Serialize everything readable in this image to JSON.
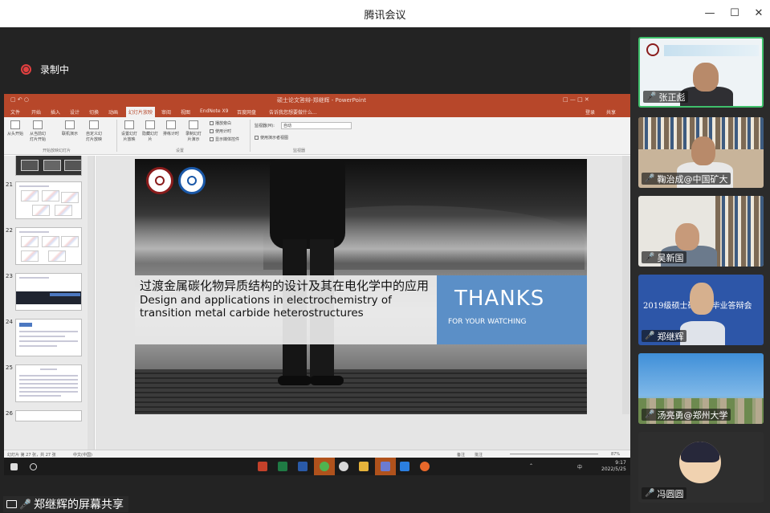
{
  "window": {
    "title": "腾讯会议"
  },
  "recording": {
    "label": "录制中"
  },
  "shared_screen": {
    "ppt_window_title": "硕士论文答辩-郑继辉 - PowerPoint",
    "ribbon_tabs": [
      "文件",
      "开始",
      "插入",
      "设计",
      "切换",
      "动画",
      "幻灯片放映",
      "审阅",
      "视图",
      "EndNote X9",
      "百度网盘"
    ],
    "active_tab": "幻灯片放映",
    "tell_me": "告诉我您想要做什么...",
    "account": "登录",
    "share": "共享",
    "ribbon_buttons": [
      "从头开始",
      "从当前幻灯片开始",
      "联机演示",
      "自定义幻灯片放映",
      "设置幻灯片放映",
      "隐藏幻灯片",
      "排练计时",
      "录制幻灯片演示"
    ],
    "ribbon_checks": [
      "播放旁白",
      "使用计时",
      "显示媒体控件"
    ],
    "monitor_label": "监视器(M):",
    "monitor_value": "自动",
    "presenter_view": "使用演示者视图",
    "groups": [
      "开始放映幻灯片",
      "设置",
      "监视器"
    ],
    "thumbnail_numbers": [
      "21",
      "22",
      "23",
      "24",
      "25",
      "26"
    ],
    "slide": {
      "title_cn": "过渡金属碳化物异质结构的设计及其在电化学中的应用",
      "title_en": "Design and applications in electrochemistry of transition metal carbide heterostructures",
      "thanks": "THANKS",
      "thanks_sub": "FOR YOUR WATCHING"
    },
    "status_bar": {
      "slide_info": "幻灯片 第 27 张，共 27 张",
      "language": "中文(中国)",
      "notes": "备注",
      "comments": "批注",
      "zoom": "87%"
    },
    "taskbar": {
      "time": "9:17",
      "date": "2022/5/25",
      "ime": "中"
    }
  },
  "share_label": {
    "text": "郑继辉的屏幕共享"
  },
  "participants": [
    {
      "name": "张正彪",
      "muted": false,
      "active": true
    },
    {
      "name": "鞠治成@中国矿大",
      "muted": true,
      "active": false
    },
    {
      "name": "吴新国",
      "muted": true,
      "active": false
    },
    {
      "name": "郑继辉",
      "muted": false,
      "active": false,
      "banner": "2019级硕士研究生毕业答辩会"
    },
    {
      "name": "汤亮勇@郑州大学",
      "muted": false,
      "active": false
    },
    {
      "name": "冯圆圆",
      "muted": true,
      "active": false
    }
  ],
  "colors": {
    "ppt_accent": "#b7472a",
    "recording_red": "#e24040",
    "active_speaker": "#3fbf6b",
    "thanks_panel": "#5b8fc7"
  }
}
